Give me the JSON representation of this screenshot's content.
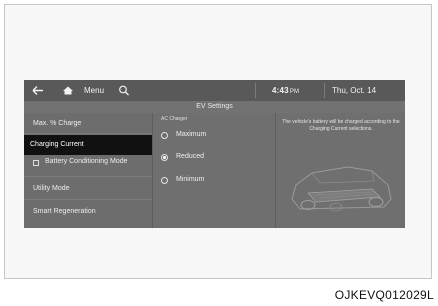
{
  "header": {
    "menu_label": "Menu",
    "time": "4:43",
    "time_suffix": "PM",
    "date": "Thu, Oct. 14",
    "icons": [
      "back-arrow-icon",
      "home-icon",
      "search-icon"
    ]
  },
  "page": {
    "title": "EV Settings"
  },
  "sidebar": {
    "items": [
      {
        "label": "Max. % Charge"
      },
      {
        "label": "Charging Current",
        "selected": true
      },
      {
        "label": "Battery Conditioning Mode",
        "has_checkbox": true,
        "checked": false
      },
      {
        "label": "Utility Mode"
      },
      {
        "label": "Smart Regeneration"
      }
    ]
  },
  "options": {
    "section_label": "AC Charger",
    "items": [
      {
        "label": "Maximum",
        "selected": false
      },
      {
        "label": "Reduced",
        "selected": true
      },
      {
        "label": "Minimum",
        "selected": false
      }
    ]
  },
  "info": {
    "text": "The vehicle's battery will be charged according to the Charging Current selections.",
    "image": "car-battery-illustration"
  },
  "caption": "OJKEVQ012029L",
  "colors": {
    "screen_bg": "#6f6f6f",
    "topbar_bg": "#595959",
    "selected_bg": "#111111",
    "text": "#eeeeee"
  }
}
